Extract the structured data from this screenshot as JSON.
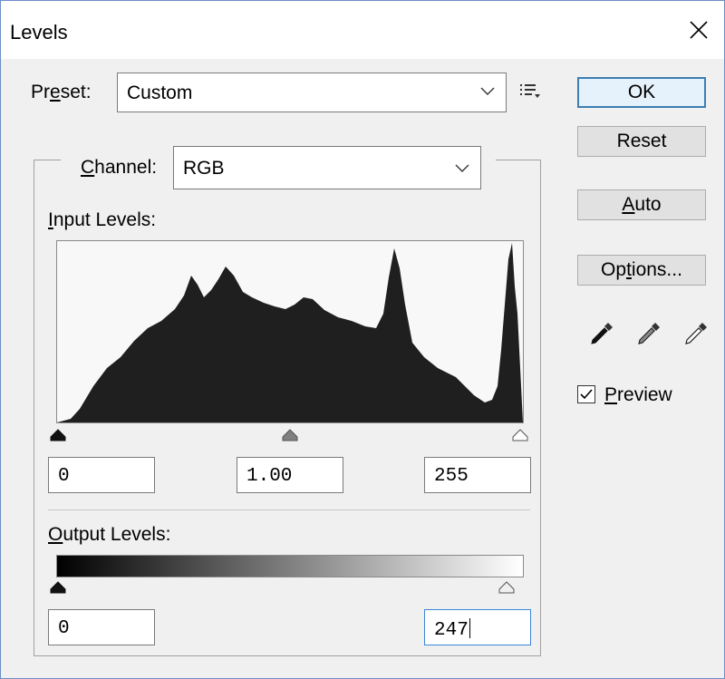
{
  "window": {
    "title": "Levels"
  },
  "preset": {
    "label_pre": "Pr",
    "label_u": "e",
    "label_post": "set:",
    "value": "Custom"
  },
  "channel": {
    "label_u": "C",
    "label_post": "hannel:",
    "value": "RGB"
  },
  "input_levels": {
    "label_u": "I",
    "label_post": "nput Levels:",
    "black": "0",
    "gamma": "1.00",
    "white": "255",
    "black_level_fraction": 0.0,
    "gamma_level_fraction": 0.5,
    "white_level_fraction": 1.0
  },
  "output_levels": {
    "label_u": "O",
    "label_post": "utput Levels:",
    "black": "0",
    "white": "247",
    "black_level_fraction": 0.0,
    "white_level_fraction": 0.969
  },
  "buttons": {
    "ok": "OK",
    "reset": "Reset",
    "auto_u": "A",
    "auto_post": "uto",
    "options_pre": "Op",
    "options_u": "t",
    "options_post": "ions..."
  },
  "preview": {
    "label_u": "P",
    "label_post": "review",
    "checked": true
  },
  "icons": {
    "close": "close-icon",
    "preset_menu": "list-menu-icon",
    "black_eyedropper": "black-eyedropper-icon",
    "gray_eyedropper": "gray-eyedropper-icon",
    "white_eyedropper": "white-eyedropper-icon"
  },
  "colors": {
    "default_button_border": "#3c7fb1",
    "active_field_border": "#3a86d8",
    "histogram_fill": "#1f1f1f"
  }
}
